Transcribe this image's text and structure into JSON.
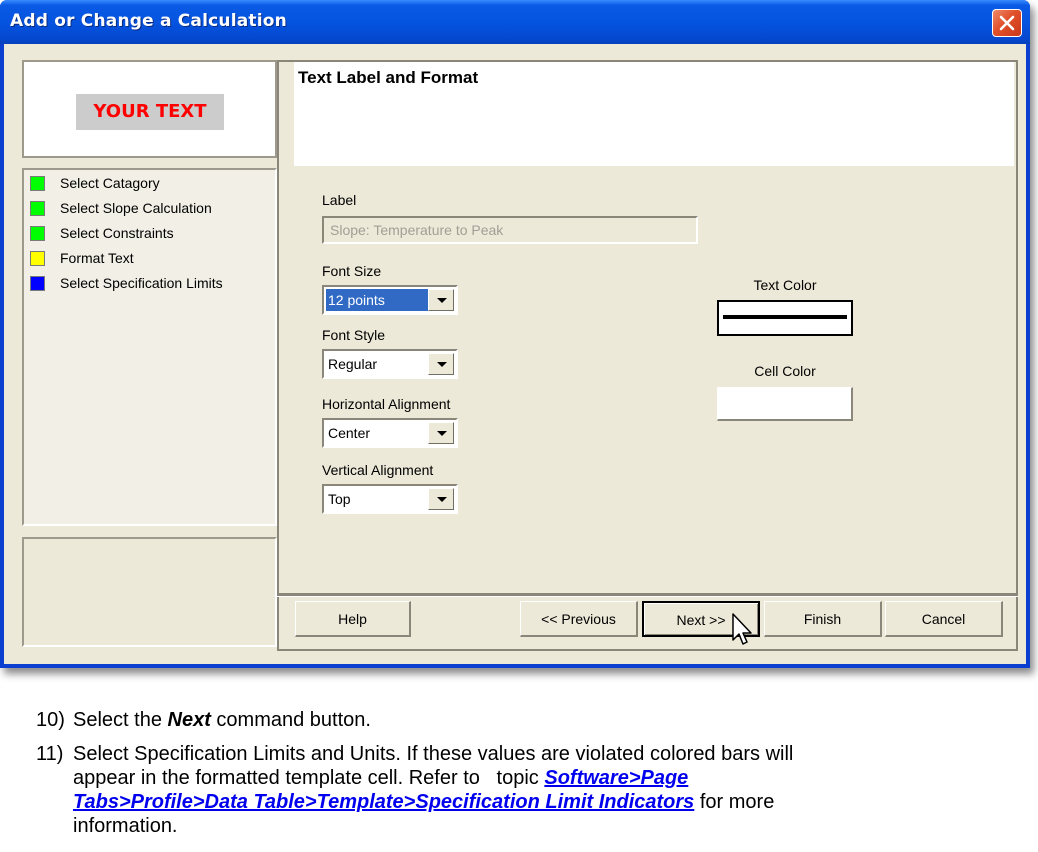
{
  "window": {
    "title": "Add or Change a Calculation",
    "close_icon": "close-x-icon"
  },
  "preview": {
    "text": "YOUR TEXT",
    "text_color": "#ff0000",
    "background_color": "#cccccc"
  },
  "steps": [
    {
      "label": "Select Catagory",
      "status_color": "#00ff00"
    },
    {
      "label": "Select Slope Calculation",
      "status_color": "#00ff00"
    },
    {
      "label": "Select Constraints",
      "status_color": "#00ff00"
    },
    {
      "label": "Format Text",
      "status_color": "#ffff00"
    },
    {
      "label": "Select Specification Limits",
      "status_color": "#0000ff"
    }
  ],
  "panel": {
    "title": "Text Label and Format",
    "label": {
      "caption": "Label",
      "value": "Slope: Temperature to Peak"
    },
    "font_size": {
      "caption": "Font Size",
      "value": "12 points"
    },
    "font_style": {
      "caption": "Font Style",
      "value": "Regular"
    },
    "horizontal_alignment": {
      "caption": "Horizontal Alignment",
      "value": "Center"
    },
    "vertical_alignment": {
      "caption": "Vertical Alignment",
      "value": "Top"
    },
    "text_color": {
      "caption": "Text Color",
      "value": "#000000"
    },
    "cell_color": {
      "caption": "Cell Color",
      "value": "#ffffff"
    }
  },
  "buttons": {
    "help": "Help",
    "previous": "<< Previous",
    "next": "Next >>",
    "finish": "Finish",
    "cancel": "Cancel"
  },
  "instructions": [
    {
      "number": "10)",
      "pre": "Select the ",
      "emphasis": "Next",
      "post": " command button."
    },
    {
      "number": "11)",
      "line1": "Select Specification Limits and Units. If these values are violated colored bars will",
      "line2_pre": "appear in the formatted template cell. Refer to   topic ",
      "link_part1": "Software>Page ",
      "link_part2": "Tabs>Profile>Data Table>Template>Specification Limit Indicators",
      "line3_post": " for more",
      "line4": "information."
    }
  ]
}
